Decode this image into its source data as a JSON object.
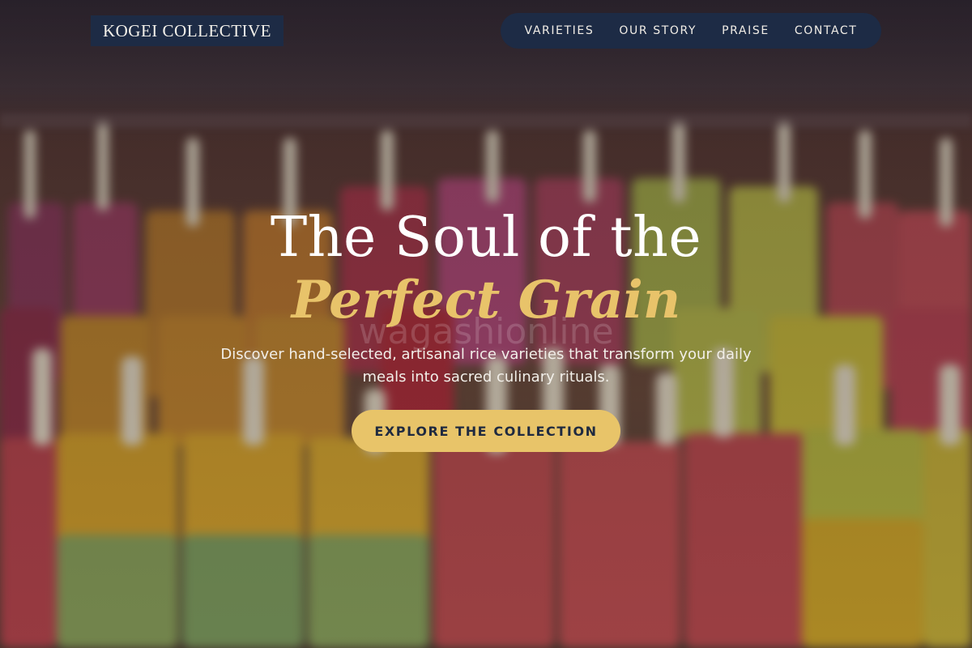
{
  "header": {
    "logo": "KOGEI COLLECTIVE",
    "nav": [
      {
        "label": "VARIETIES"
      },
      {
        "label": "OUR STORY"
      },
      {
        "label": "PRAISE"
      },
      {
        "label": "CONTACT"
      }
    ]
  },
  "hero": {
    "headline_line1": "The Soul of the",
    "headline_line2": "Perfect Grain",
    "watermark": "wagashionline",
    "subtitle": "Discover hand-selected, artisanal rice varieties that transform your daily meals into sacred culinary rituals.",
    "cta_label": "EXPLORE THE COLLECTION"
  },
  "colors": {
    "navy": "#1d2b45",
    "gold": "#e8c469",
    "text_light": "#f2efe9"
  }
}
